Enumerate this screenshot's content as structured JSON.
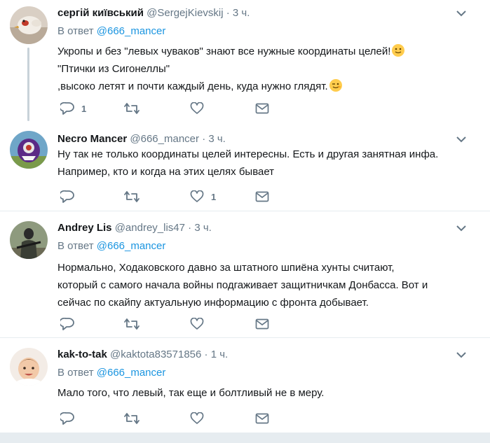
{
  "tweets": [
    {
      "name": "сергій київський",
      "handle": "@SergejKievskij",
      "time": "3 ч.",
      "reply_prefix": "В ответ",
      "reply_to": "@666_mancer",
      "lines": [
        "Укропы и без \"левых чуваков\" знают все нужные координаты целей!",
        "\"Птички из Сигонеллы\"",
        ",высоко летят и почти каждый день, куда нужно глядят."
      ],
      "emojis": [
        "slightly-smiling-face",
        "winking-face"
      ],
      "reply_count": "1",
      "retweet_count": "",
      "like_count": ""
    },
    {
      "name": "Necro Mancer",
      "handle": "@666_mancer",
      "time": "3 ч.",
      "lines": [
        "Ну так не только координаты целей интересны. Есть и другая занятная инфа.",
        "Например, кто и когда на этих целях бывает"
      ],
      "reply_count": "",
      "retweet_count": "",
      "like_count": "1"
    },
    {
      "name": "Andrey Lis",
      "handle": "@andrey_lis47",
      "time": "3 ч.",
      "reply_prefix": "В ответ",
      "reply_to": "@666_mancer",
      "lines": [
        "Нормально, Ходаковского давно за штатного шпиёна хунты считают,",
        "который с самого начала войны подгаживает защитничкам Донбасса. Вот и",
        "сейчас по скайпу актуальную информацию с фронта добывает."
      ],
      "reply_count": "",
      "retweet_count": "",
      "like_count": ""
    },
    {
      "name": "kak-to-tak",
      "handle": "@kaktota83571856",
      "time": "1 ч.",
      "reply_prefix": "В ответ",
      "reply_to": "@666_mancer",
      "lines": [
        "Мало того, что левый, так еще и болтливый не в меру."
      ],
      "reply_count": "",
      "retweet_count": "",
      "like_count": ""
    }
  ],
  "separator": "·",
  "icons": {
    "reply": "reply-icon",
    "retweet": "retweet-icon",
    "like": "heart-icon",
    "dm": "envelope-icon",
    "more": "chevron-down-icon"
  },
  "colors": {
    "accent": "#1b95e0",
    "secondary": "#657786",
    "border": "#e6ecf0"
  }
}
